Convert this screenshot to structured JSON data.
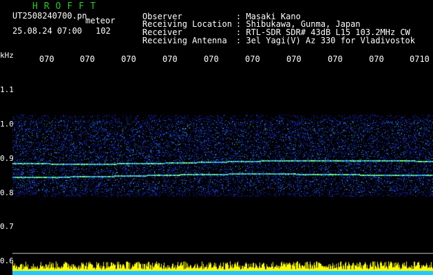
{
  "header": {
    "logo": "HROFFT",
    "filename": "UT2508240700.pn",
    "mode": "meteor",
    "datetime": "25.08.24 07:00",
    "count": "102"
  },
  "meta": [
    {
      "key": "Observer",
      "value": ": Masaki Kano"
    },
    {
      "key": "Receiving Location",
      "value": ": Shibukawa, Gunma, Japan"
    },
    {
      "key": "Receiver",
      "value": ": RTL-SDR SDR# 43dB L15 103.2MHz CW"
    },
    {
      "key": "Receiving Antenna",
      "value": ": 3el Yagi(V) Az 330 for Vladivostok"
    }
  ],
  "axis": {
    "unit": "kHz",
    "time_ticks": [
      "070",
      "070",
      "070",
      "070",
      "070",
      "070",
      "070",
      "070",
      "070",
      "0710"
    ],
    "freq_ticks": [
      "1.1",
      "1.0",
      "0.9",
      "0.8",
      "0.7",
      "0.6"
    ]
  },
  "colors": {
    "background": "#000000",
    "signal_low": "#1a2bd0",
    "signal_mid": "#2a9cf0",
    "signal_high": "#7dff6a",
    "amplitude_bar": "#ffff00",
    "logo": "#22cc22"
  },
  "spectrogram": {
    "band_range_khz": [
      0.8,
      1.01
    ],
    "carrier_khz": [
      0.885,
      0.848
    ]
  }
}
